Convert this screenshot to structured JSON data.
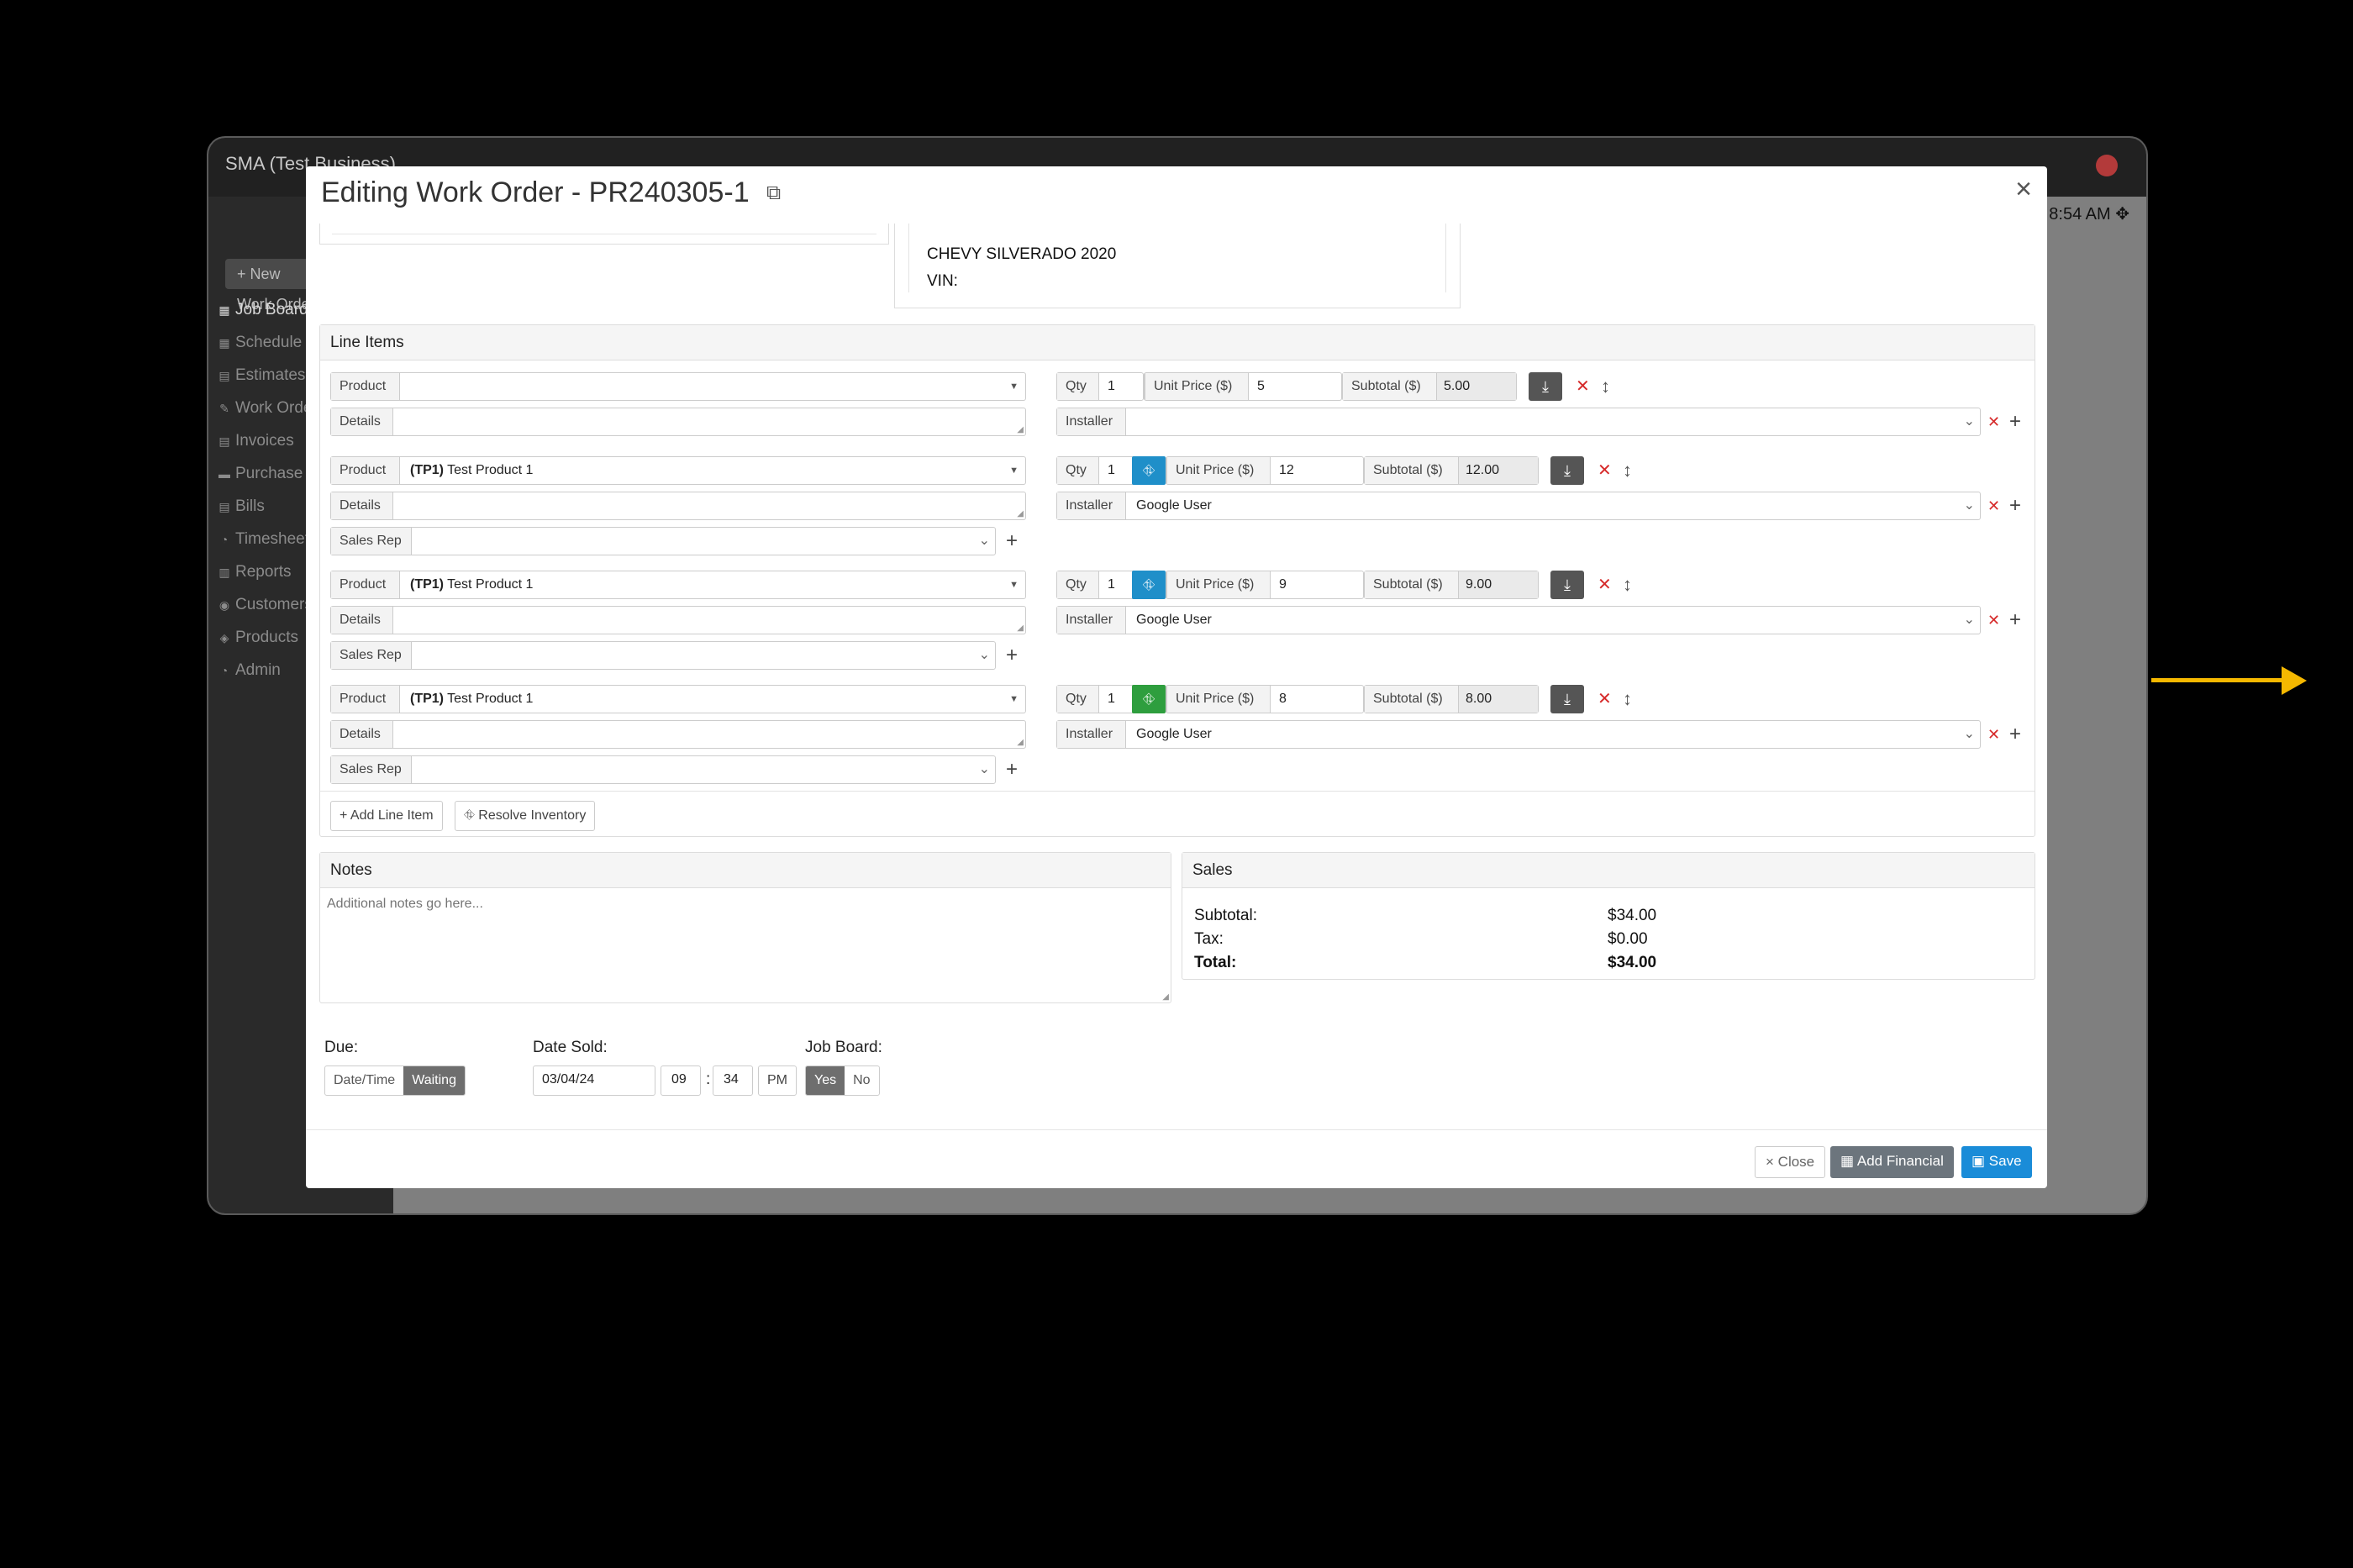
{
  "app": {
    "title": "SMA (Test Business)",
    "new_button": "+ New Work Order",
    "clock": "8:54 AM",
    "sidebar": [
      {
        "icon": "▦",
        "label": "Job Board",
        "active": true
      },
      {
        "icon": "▦",
        "label": "Schedule"
      },
      {
        "icon": "▤",
        "label": "Estimates"
      },
      {
        "icon": "✎",
        "label": "Work Orders"
      },
      {
        "icon": "▤",
        "label": "Invoices"
      },
      {
        "icon": "▬",
        "label": "Purchase Orders"
      },
      {
        "icon": "▤",
        "label": "Bills"
      },
      {
        "icon": "◔",
        "label": "Timesheets"
      },
      {
        "icon": "▥",
        "label": "Reports"
      },
      {
        "icon": "◉",
        "label": "Customers"
      },
      {
        "icon": "◈",
        "label": "Products"
      },
      {
        "icon": "◔",
        "label": "Admin"
      }
    ]
  },
  "modal": {
    "title": "Editing Work Order - PR240305-1",
    "close_glyph": "×",
    "vehicle": {
      "model": "CHEVY SILVERADO 2020",
      "vin_label": "VIN:"
    },
    "line_items": {
      "heading": "Line Items",
      "labels": {
        "product": "Product",
        "details": "Details",
        "sales_rep": "Sales Rep",
        "qty": "Qty",
        "unit_price": "Unit Price ($)",
        "subtotal": "Subtotal ($)",
        "installer": "Installer"
      },
      "items": [
        {
          "product_code": "",
          "product_name": "",
          "qty": "1",
          "unit_price": "5",
          "subtotal": "5.00",
          "installer": "",
          "inventory_color": ""
        },
        {
          "product_code": "(TP1)",
          "product_name": "Test Product 1",
          "qty": "1",
          "unit_price": "12",
          "subtotal": "12.00",
          "installer": "Google User",
          "inventory_color": "#1f8fc9"
        },
        {
          "product_code": "(TP1)",
          "product_name": "Test Product 1",
          "qty": "1",
          "unit_price": "9",
          "subtotal": "9.00",
          "installer": "Google User",
          "inventory_color": "#1f8fc9"
        },
        {
          "product_code": "(TP1)",
          "product_name": "Test Product 1",
          "qty": "1",
          "unit_price": "8",
          "subtotal": "8.00",
          "installer": "Google User",
          "inventory_color": "#2e9e3e"
        }
      ],
      "add_line_item": "+ Add Line Item",
      "resolve_inventory": "Resolve Inventory"
    },
    "notes": {
      "heading": "Notes",
      "placeholder": "Additional notes go here..."
    },
    "sales": {
      "heading": "Sales",
      "subtotal_label": "Subtotal:",
      "subtotal_value": "$34.00",
      "tax_label": "Tax:",
      "tax_value": "$0.00",
      "total_label": "Total:",
      "total_value": "$34.00"
    },
    "due": {
      "label": "Due:",
      "option_datetime": "Date/Time",
      "option_waiting": "Waiting"
    },
    "date_sold": {
      "label": "Date Sold:",
      "date": "03/04/24",
      "hour": "09",
      "sep": ":",
      "minute": "34",
      "ampm": "PM"
    },
    "job_board": {
      "label": "Job Board:",
      "yes": "Yes",
      "no": "No"
    },
    "footer": {
      "close": "Close",
      "add_financial": "Add Financial",
      "save": "Save"
    }
  },
  "colors": {
    "primary": "#1a8cd8",
    "dark_button": "#6c757d",
    "danger": "#d62a2a",
    "accent_arrow": "#f5b800"
  }
}
